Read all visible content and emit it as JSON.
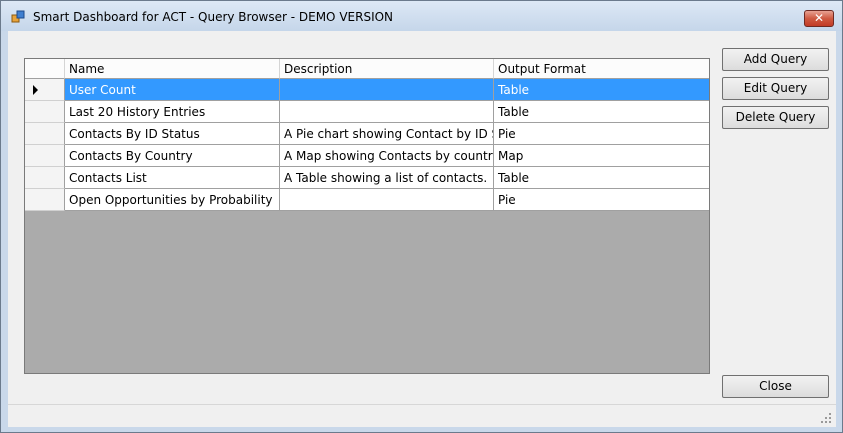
{
  "window": {
    "title": "Smart Dashboard for ACT - Query Browser - DEMO VERSION",
    "close_icon": "✕"
  },
  "grid": {
    "columns": [
      "Name",
      "Description",
      "Output Format"
    ],
    "rows": [
      {
        "name": "User Count",
        "description": "",
        "format": "Table",
        "selected": true
      },
      {
        "name": "Last 20 History Entries",
        "description": "",
        "format": "Table"
      },
      {
        "name": "Contacts By ID Status",
        "description": "A Pie chart showing Contact by ID Status.",
        "format": "Pie"
      },
      {
        "name": "Contacts By Country",
        "description": "A Map showing Contacts by country.",
        "format": "Map"
      },
      {
        "name": "Contacts List",
        "description": "A Table showing a list of contacts.",
        "format": "Table"
      },
      {
        "name": "Open Opportunities by Probability",
        "description": "",
        "format": "Pie"
      }
    ]
  },
  "buttons": {
    "add": "Add Query",
    "edit": "Edit Query",
    "delete": "Delete Query",
    "close": "Close"
  },
  "colors": {
    "selection": "#3399ff",
    "grid_background": "#ababab"
  }
}
